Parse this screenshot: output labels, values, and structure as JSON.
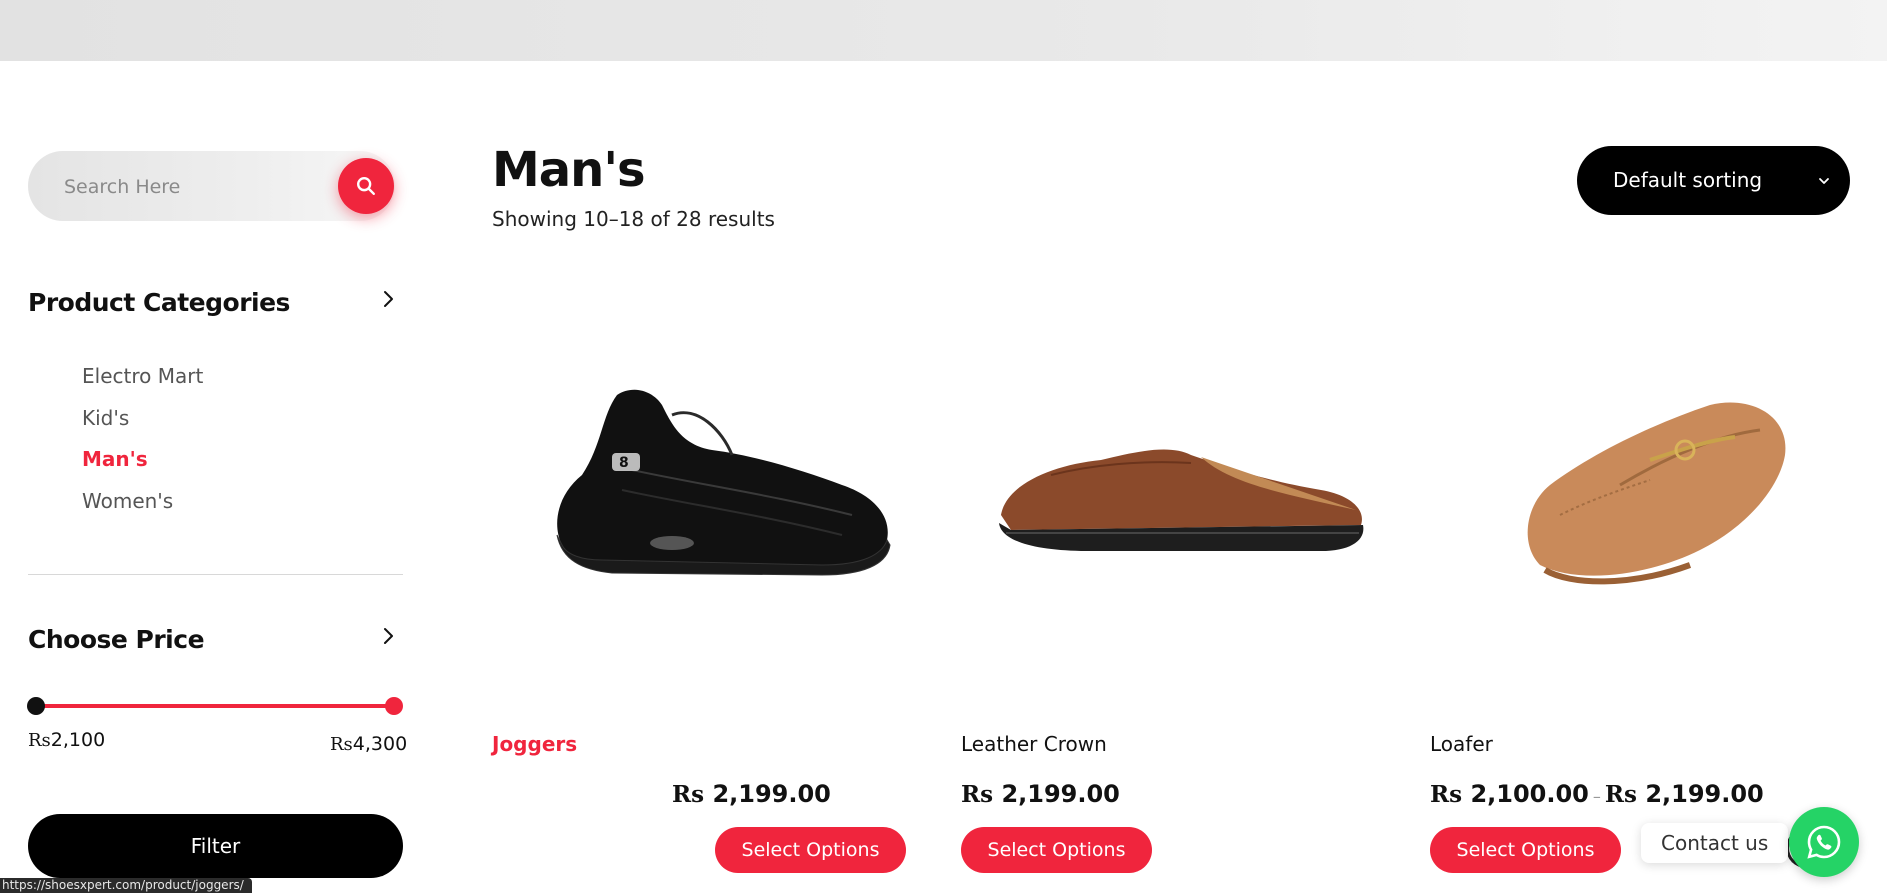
{
  "search": {
    "placeholder": "Search Here"
  },
  "sidebar": {
    "categories_heading": "Product Categories",
    "categories": [
      {
        "label": "Electro Mart",
        "active": false
      },
      {
        "label": "Kid's",
        "active": false
      },
      {
        "label": "Man's",
        "active": true
      },
      {
        "label": "Women's",
        "active": false
      }
    ],
    "price_heading": "Choose Price",
    "price": {
      "currency": "Rs",
      "min": "2,100",
      "max": "4,300"
    },
    "filter_label": "Filter"
  },
  "main": {
    "title": "Man's",
    "result_count": "Showing 10–18 of 28 results",
    "sort_label": "Default sorting"
  },
  "products": [
    {
      "name": "Joggers",
      "currency": "Rs",
      "price": "2,199.00",
      "button": "Select Options",
      "active": true,
      "image": "black-sneaker"
    },
    {
      "name": "Leather Crown",
      "currency": "Rs",
      "price": "2,199.00",
      "button": "Select Options",
      "active": false,
      "image": "brown-mule"
    },
    {
      "name": "Loafer",
      "currency": "Rs",
      "price_from": "2,100.00",
      "price_to": "2,199.00",
      "price_sep": "–",
      "button": "Select Options",
      "active": false,
      "image": "tan-loafer"
    }
  ],
  "contact": {
    "label": "Contact us",
    "icon": "whatsapp-icon"
  },
  "status_bar": {
    "url": "https://shoesxpert.com/product/joggers/"
  },
  "colors": {
    "accent": "#f0253d",
    "dark": "#000000",
    "whatsapp": "#25d366"
  }
}
